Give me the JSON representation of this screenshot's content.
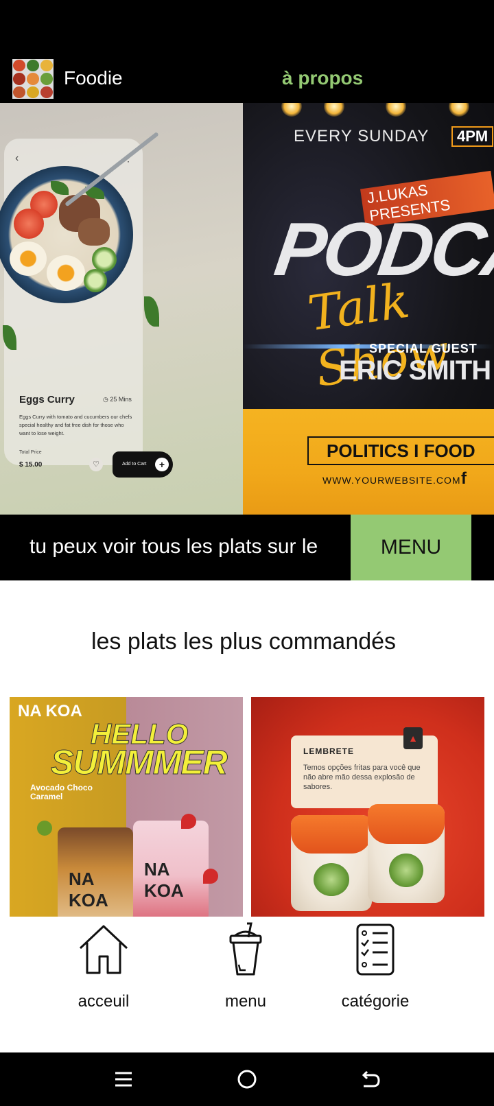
{
  "header": {
    "app_title": "Foodie",
    "about_link": "à propos"
  },
  "banner": {
    "food_card": {
      "name": "Eggs Curry",
      "time": "25 Mins",
      "description": "Eggs Curry with tomato and cucumbers our chefs special healthy and fat free dish for those who want to lose weight.",
      "total_label": "Total Price",
      "price": "$ 15.00",
      "cart_button": "Add to Cart"
    },
    "podcast": {
      "every": "EVERY SUNDAY",
      "time": "4PM",
      "presents": "J.LUKAS PRESENTS",
      "title": "PODCAST",
      "subtitle": "Talk Show",
      "guest_label": "SPECIAL GUEST",
      "guest_name": "ERIC SMITH",
      "topics": "POLITICS I FOOD",
      "website": "WWW.YOURWEBSITE.COM",
      "social": "f"
    }
  },
  "marquee": {
    "text": "tu peux voir tous les plats sur le",
    "menu_button": "MENU"
  },
  "popular": {
    "title": "les plats les plus commandés",
    "dishes": [
      {
        "brand": "NA KOA",
        "headline_1": "HELLO",
        "headline_2": "SUMMMER",
        "flavor": "Avocado Choco Caramel",
        "cup_label": "NA KOA"
      },
      {
        "reminder_title": "LEMBRETE",
        "reminder_body": "Temos opções fritas para você que não abre mão dessa explosão de sabores."
      }
    ]
  },
  "bottom_nav": {
    "items": [
      {
        "label": "acceuil",
        "icon": "home-icon"
      },
      {
        "label": "menu",
        "icon": "drink-cup-icon"
      },
      {
        "label": "catégorie",
        "icon": "checklist-icon"
      }
    ]
  },
  "system_nav": {
    "icons": [
      "menu-lines-icon",
      "home-circle-icon",
      "back-arrow-icon"
    ]
  },
  "colors": {
    "accent": "#94c973",
    "background": "#000000",
    "content_bg": "#ffffff"
  }
}
